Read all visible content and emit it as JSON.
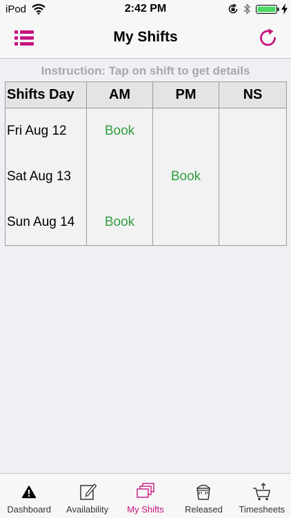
{
  "status": {
    "carrier": "iPod",
    "time": "2:42 PM"
  },
  "nav": {
    "title": "My Shifts",
    "accent_color": "#c4157f"
  },
  "instruction": "Instruction: Tap on shift to get details",
  "table": {
    "headers": [
      "Shifts Day",
      "AM",
      "PM",
      "NS"
    ],
    "rows": [
      {
        "day": "Fri Aug 12",
        "am": "Book",
        "pm": "",
        "ns": ""
      },
      {
        "day": "Sat Aug 13",
        "am": "",
        "pm": "Book",
        "ns": ""
      },
      {
        "day": "Sun Aug 14",
        "am": "Book",
        "pm": "",
        "ns": ""
      }
    ],
    "book_color": "#2f9e3f"
  },
  "tabs": [
    {
      "label": "Dashboard",
      "icon": "warning-icon"
    },
    {
      "label": "Availability",
      "icon": "edit-icon"
    },
    {
      "label": "My Shifts",
      "icon": "stacked-pages-icon",
      "active": true
    },
    {
      "label": "Released",
      "icon": "bucket-icon"
    },
    {
      "label": "Timesheets",
      "icon": "cart-icon"
    }
  ]
}
